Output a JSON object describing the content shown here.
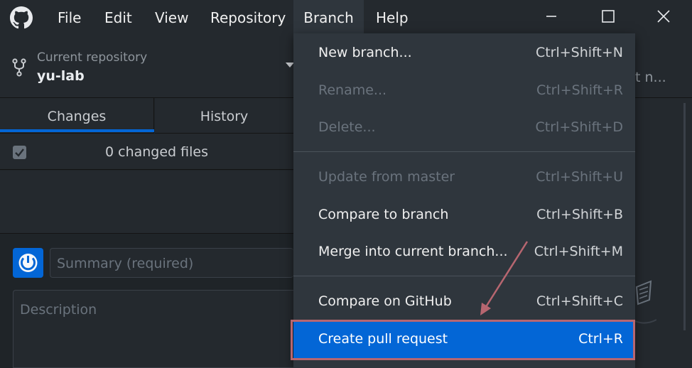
{
  "menubar": {
    "items": [
      "File",
      "Edit",
      "View",
      "Repository",
      "Branch",
      "Help"
    ],
    "active": "Branch"
  },
  "repo": {
    "label": "Current repository",
    "name": "yu-lab",
    "right_text_partial": "t n..."
  },
  "tabs": {
    "changes": "Changes",
    "history": "History"
  },
  "changes": {
    "count_text": "0 changed files"
  },
  "commit": {
    "summary_placeholder": "Summary (required)",
    "description_placeholder": "Description"
  },
  "branch_menu": {
    "items": [
      {
        "label": "New branch...",
        "accel": "Ctrl+Shift+N",
        "enabled": true
      },
      {
        "label": "Rename...",
        "accel": "Ctrl+Shift+R",
        "enabled": false
      },
      {
        "label": "Delete...",
        "accel": "Ctrl+Shift+D",
        "enabled": false
      },
      {
        "label": "Update from master",
        "accel": "Ctrl+Shift+U",
        "enabled": false
      },
      {
        "label": "Compare to branch",
        "accel": "Ctrl+Shift+B",
        "enabled": true
      },
      {
        "label": "Merge into current branch...",
        "accel": "Ctrl+Shift+M",
        "enabled": true
      },
      {
        "label": "Compare on GitHub",
        "accel": "Ctrl+Shift+C",
        "enabled": true
      },
      {
        "label": "Create pull request",
        "accel": "Ctrl+R",
        "enabled": true,
        "highlighted": true
      }
    ]
  },
  "colors": {
    "accent": "#0366d6",
    "annotation": "#b76670"
  },
  "icons": [
    "github-logo-icon",
    "repo-fork-icon",
    "minimize-icon",
    "maximize-icon",
    "close-icon",
    "sync-icon"
  ]
}
